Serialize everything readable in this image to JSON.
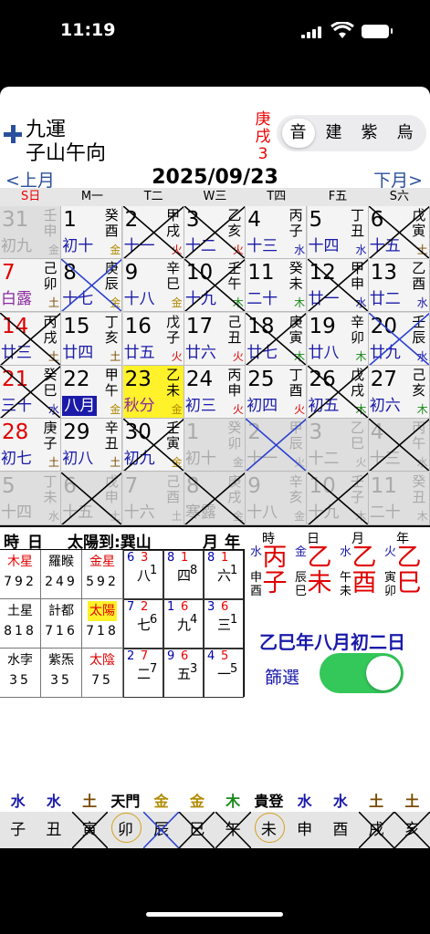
{
  "status": {
    "time": "11:19"
  },
  "header": {
    "title_line1": "九運",
    "title_line2": "子山午向",
    "ganzhi_chars": [
      "庚",
      "戌",
      "3"
    ],
    "segments": [
      "音",
      "建",
      "紫",
      "烏"
    ],
    "selected_segment": 0
  },
  "nav": {
    "prev": "<上月",
    "date": "2025/09/23",
    "next": "下月>"
  },
  "weekdays": [
    "S日",
    "M一",
    "T二",
    "W三",
    "T四",
    "F五",
    "S六"
  ],
  "colors": {
    "red": "#e00000",
    "blue": "#1a1aaa",
    "green": "#1a8a1a",
    "gold": "#b08a00",
    "brown": "#7a4a00",
    "purple": "#8a2aa0",
    "today": "#fff12a",
    "toggle": "#34c759"
  },
  "calendar": [
    [
      {
        "d": "31",
        "l": "初九",
        "g": "壬申",
        "e": "金",
        "out": true,
        "lc": "blue"
      },
      {
        "d": "1",
        "l": "初十",
        "g": "癸酉",
        "e": "金",
        "lc": "blue",
        "ec": "gold"
      },
      {
        "d": "2",
        "l": "十一",
        "g": "甲戌",
        "e": "火",
        "lc": "blue",
        "ec": "red",
        "x": "black"
      },
      {
        "d": "3",
        "l": "十二",
        "g": "乙亥",
        "e": "火",
        "lc": "blue",
        "ec": "red",
        "x": "black"
      },
      {
        "d": "4",
        "l": "十三",
        "g": "丙子",
        "e": "水",
        "lc": "blue",
        "ec": "blue"
      },
      {
        "d": "5",
        "l": "十四",
        "g": "丁丑",
        "e": "水",
        "lc": "blue",
        "ec": "blue"
      },
      {
        "d": "6",
        "l": "十五",
        "g": "戊寅",
        "e": "土",
        "lc": "blue",
        "ec": "brown",
        "x": "black"
      }
    ],
    [
      {
        "d": "7",
        "l": "白露",
        "g": "己卯",
        "e": "土",
        "dc": "red",
        "lc": "purple",
        "ec": "brown"
      },
      {
        "d": "8",
        "l": "十七",
        "g": "庚辰",
        "e": "金",
        "lc": "blue",
        "ec": "gold",
        "x": "blue"
      },
      {
        "d": "9",
        "l": "十八",
        "g": "辛巳",
        "e": "金",
        "lc": "blue",
        "ec": "gold"
      },
      {
        "d": "10",
        "l": "十九",
        "g": "壬午",
        "e": "木",
        "lc": "blue",
        "ec": "green",
        "x": "black"
      },
      {
        "d": "11",
        "l": "二十",
        "g": "癸未",
        "e": "木",
        "lc": "blue",
        "ec": "green"
      },
      {
        "d": "12",
        "l": "廿一",
        "g": "甲申",
        "e": "水",
        "lc": "blue",
        "ec": "blue",
        "x": "black"
      },
      {
        "d": "13",
        "l": "廿二",
        "g": "乙酉",
        "e": "水",
        "lc": "blue",
        "ec": "blue"
      }
    ],
    [
      {
        "d": "14",
        "l": "廿三",
        "g": "丙戌",
        "e": "土",
        "dc": "red",
        "lc": "blue",
        "ec": "brown",
        "x": "black"
      },
      {
        "d": "15",
        "l": "廿四",
        "g": "丁亥",
        "e": "土",
        "lc": "blue",
        "ec": "brown"
      },
      {
        "d": "16",
        "l": "廿五",
        "g": "戊子",
        "e": "火",
        "lc": "blue",
        "ec": "red"
      },
      {
        "d": "17",
        "l": "廿六",
        "g": "己丑",
        "e": "火",
        "lc": "blue",
        "ec": "red"
      },
      {
        "d": "18",
        "l": "廿七",
        "g": "庚寅",
        "e": "木",
        "lc": "blue",
        "ec": "green",
        "x": "black"
      },
      {
        "d": "19",
        "l": "廿八",
        "g": "辛卯",
        "e": "木",
        "lc": "blue",
        "ec": "green"
      },
      {
        "d": "20",
        "l": "廿九",
        "g": "壬辰",
        "e": "水",
        "lc": "blue",
        "ec": "blue",
        "x": "blue"
      }
    ],
    [
      {
        "d": "21",
        "l": "三十",
        "g": "癸巳",
        "e": "水",
        "dc": "red",
        "lc": "blue",
        "ec": "blue",
        "x": "black"
      },
      {
        "d": "22",
        "l": "八月",
        "g": "甲午",
        "e": "金",
        "lc": "white",
        "lbg": "#1a1aaa",
        "ec": "gold"
      },
      {
        "d": "23",
        "l": "秋分",
        "g": "乙未",
        "e": "金",
        "lc": "purple",
        "ec": "gold",
        "today": true
      },
      {
        "d": "24",
        "l": "初三",
        "g": "丙申",
        "e": "火",
        "lc": "blue",
        "ec": "red"
      },
      {
        "d": "25",
        "l": "初四",
        "g": "丁酉",
        "e": "火",
        "lc": "blue",
        "ec": "red"
      },
      {
        "d": "26",
        "l": "初五",
        "g": "戊戌",
        "e": "木",
        "lc": "blue",
        "ec": "green",
        "x": "black"
      },
      {
        "d": "27",
        "l": "初六",
        "g": "己亥",
        "e": "木",
        "lc": "blue",
        "ec": "green"
      }
    ],
    [
      {
        "d": "28",
        "l": "初七",
        "g": "庚子",
        "e": "土",
        "dc": "red",
        "lc": "blue",
        "ec": "brown"
      },
      {
        "d": "29",
        "l": "初八",
        "g": "辛丑",
        "e": "土",
        "lc": "blue",
        "ec": "brown"
      },
      {
        "d": "30",
        "l": "初九",
        "g": "壬寅",
        "e": "金",
        "lc": "blue",
        "ec": "gold",
        "x": "black"
      },
      {
        "d": "1",
        "l": "初十",
        "g": "癸卯",
        "e": "金",
        "out": true
      },
      {
        "d": "2",
        "l": "十一",
        "g": "甲辰",
        "e": "火",
        "out": true,
        "x": "blue"
      },
      {
        "d": "3",
        "l": "十二",
        "g": "乙巳",
        "e": "火",
        "out": true
      },
      {
        "d": "4",
        "l": "十三",
        "g": "丙午",
        "e": "水",
        "out": true,
        "x": "black"
      }
    ],
    [
      {
        "d": "5",
        "l": "十四",
        "g": "丁未",
        "e": "水",
        "out": true
      },
      {
        "d": "6",
        "l": "十五",
        "g": "戊申",
        "e": "土",
        "out": true,
        "x": "black"
      },
      {
        "d": "7",
        "l": "十六",
        "g": "己酉",
        "e": "土",
        "out": true
      },
      {
        "d": "8",
        "l": "寒露",
        "g": "庚戌",
        "e": "金",
        "out": true,
        "x": "black"
      },
      {
        "d": "9",
        "l": "十八",
        "g": "辛亥",
        "e": "金",
        "out": true
      },
      {
        "d": "10",
        "l": "十九",
        "g": "壬子",
        "e": "木",
        "out": true,
        "x": "black"
      },
      {
        "d": "11",
        "l": "二十",
        "g": "癸丑",
        "e": "木",
        "out": true
      }
    ]
  ],
  "info": {
    "header_labels": [
      "時",
      "日",
      "太陽到:巽山",
      "月",
      "年"
    ],
    "stars": [
      {
        "n": "木星",
        "c": "red",
        "nums": "792"
      },
      {
        "n": "羅睺",
        "c": "black",
        "nums": "249"
      },
      {
        "n": "金星",
        "c": "red",
        "nums": "592"
      },
      {
        "n": "土星",
        "c": "black",
        "nums": "818"
      },
      {
        "n": "計都",
        "c": "black",
        "nums": "716"
      },
      {
        "n": "太陽",
        "c": "red",
        "bg": "#fff12a",
        "nums": "718"
      },
      {
        "n": "水孛",
        "c": "black",
        "nums": "35"
      },
      {
        "n": "紫炁",
        "c": "black",
        "nums": "35"
      },
      {
        "n": "太陰",
        "c": "red",
        "nums": "75"
      }
    ],
    "nine": [
      {
        "a": "6",
        "b": "3",
        "c": "八",
        "d": "1"
      },
      {
        "a": "8",
        "b": "1",
        "c": "四",
        "d": "8"
      },
      {
        "a": "8",
        "b": "1",
        "c": "六",
        "d": "1"
      },
      {
        "a": "7",
        "b": "2",
        "c": "七",
        "d": "6"
      },
      {
        "a": "1",
        "b": "6",
        "c": "九",
        "d": "4"
      },
      {
        "a": "3",
        "b": "6",
        "c": "三",
        "d": "1"
      },
      {
        "a": "2",
        "b": "7",
        "c": "二",
        "d": "7"
      },
      {
        "a": "9",
        "b": "6",
        "c": "五",
        "d": "3"
      },
      {
        "a": "4",
        "b": "5",
        "c": "一",
        "d": "5"
      }
    ],
    "pillars": [
      {
        "h": "時",
        "tg": "丙",
        "tgc": "red",
        "tge": "水",
        "dz": "子",
        "dzc": "red",
        "sub": "申酉"
      },
      {
        "h": "日",
        "tg": "乙",
        "tgc": "red",
        "tge": "金",
        "dz": "未",
        "dzc": "red",
        "sub": "辰巳"
      },
      {
        "h": "月",
        "tg": "乙",
        "tgc": "red",
        "tge": "水",
        "dz": "酉",
        "dzc": "red",
        "sub": "午未"
      },
      {
        "h": "年",
        "tg": "乙",
        "tgc": "red",
        "tge": "火",
        "dz": "巳",
        "dzc": "red",
        "sub": "寅卯"
      }
    ],
    "lunar_date": "乙巳年八月初二日",
    "filter_label": "篩選",
    "filter_on": true
  },
  "bottom": {
    "elements": [
      {
        "t": "水",
        "c": "blue"
      },
      {
        "t": "水",
        "c": "blue"
      },
      {
        "t": "土",
        "c": "brown"
      },
      {
        "t": "天門",
        "c": "black"
      },
      {
        "t": "金",
        "c": "gold"
      },
      {
        "t": "金",
        "c": "gold"
      },
      {
        "t": "木",
        "c": "green"
      },
      {
        "t": "貴登",
        "c": "black"
      },
      {
        "t": "水",
        "c": "blue"
      },
      {
        "t": "水",
        "c": "blue"
      },
      {
        "t": "土",
        "c": "brown"
      },
      {
        "t": "土",
        "c": "brown"
      }
    ],
    "branches": [
      {
        "t": "子"
      },
      {
        "t": "丑"
      },
      {
        "t": "寅",
        "x": "black"
      },
      {
        "t": "卯",
        "circle": true
      },
      {
        "t": "辰",
        "x": "blue"
      },
      {
        "t": "巳",
        "x": "black"
      },
      {
        "t": "午",
        "x": "black"
      },
      {
        "t": "未",
        "circle": true
      },
      {
        "t": "申"
      },
      {
        "t": "酉"
      },
      {
        "t": "戌",
        "x": "black"
      },
      {
        "t": "亥",
        "x": "black"
      }
    ]
  }
}
